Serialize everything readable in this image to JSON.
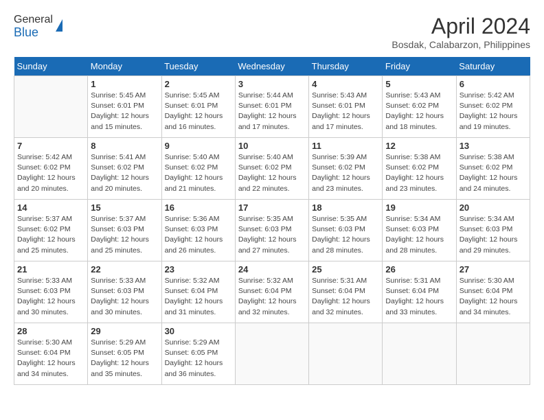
{
  "header": {
    "logo_general": "General",
    "logo_blue": "Blue",
    "month_title": "April 2024",
    "location": "Bosdak, Calabarzon, Philippines"
  },
  "columns": [
    "Sunday",
    "Monday",
    "Tuesday",
    "Wednesday",
    "Thursday",
    "Friday",
    "Saturday"
  ],
  "weeks": [
    [
      {
        "day": "",
        "info": ""
      },
      {
        "day": "1",
        "info": "Sunrise: 5:45 AM\nSunset: 6:01 PM\nDaylight: 12 hours\nand 15 minutes."
      },
      {
        "day": "2",
        "info": "Sunrise: 5:45 AM\nSunset: 6:01 PM\nDaylight: 12 hours\nand 16 minutes."
      },
      {
        "day": "3",
        "info": "Sunrise: 5:44 AM\nSunset: 6:01 PM\nDaylight: 12 hours\nand 17 minutes."
      },
      {
        "day": "4",
        "info": "Sunrise: 5:43 AM\nSunset: 6:01 PM\nDaylight: 12 hours\nand 17 minutes."
      },
      {
        "day": "5",
        "info": "Sunrise: 5:43 AM\nSunset: 6:02 PM\nDaylight: 12 hours\nand 18 minutes."
      },
      {
        "day": "6",
        "info": "Sunrise: 5:42 AM\nSunset: 6:02 PM\nDaylight: 12 hours\nand 19 minutes."
      }
    ],
    [
      {
        "day": "7",
        "info": "Sunrise: 5:42 AM\nSunset: 6:02 PM\nDaylight: 12 hours\nand 20 minutes."
      },
      {
        "day": "8",
        "info": "Sunrise: 5:41 AM\nSunset: 6:02 PM\nDaylight: 12 hours\nand 20 minutes."
      },
      {
        "day": "9",
        "info": "Sunrise: 5:40 AM\nSunset: 6:02 PM\nDaylight: 12 hours\nand 21 minutes."
      },
      {
        "day": "10",
        "info": "Sunrise: 5:40 AM\nSunset: 6:02 PM\nDaylight: 12 hours\nand 22 minutes."
      },
      {
        "day": "11",
        "info": "Sunrise: 5:39 AM\nSunset: 6:02 PM\nDaylight: 12 hours\nand 23 minutes."
      },
      {
        "day": "12",
        "info": "Sunrise: 5:38 AM\nSunset: 6:02 PM\nDaylight: 12 hours\nand 23 minutes."
      },
      {
        "day": "13",
        "info": "Sunrise: 5:38 AM\nSunset: 6:02 PM\nDaylight: 12 hours\nand 24 minutes."
      }
    ],
    [
      {
        "day": "14",
        "info": "Sunrise: 5:37 AM\nSunset: 6:02 PM\nDaylight: 12 hours\nand 25 minutes."
      },
      {
        "day": "15",
        "info": "Sunrise: 5:37 AM\nSunset: 6:03 PM\nDaylight: 12 hours\nand 25 minutes."
      },
      {
        "day": "16",
        "info": "Sunrise: 5:36 AM\nSunset: 6:03 PM\nDaylight: 12 hours\nand 26 minutes."
      },
      {
        "day": "17",
        "info": "Sunrise: 5:35 AM\nSunset: 6:03 PM\nDaylight: 12 hours\nand 27 minutes."
      },
      {
        "day": "18",
        "info": "Sunrise: 5:35 AM\nSunset: 6:03 PM\nDaylight: 12 hours\nand 28 minutes."
      },
      {
        "day": "19",
        "info": "Sunrise: 5:34 AM\nSunset: 6:03 PM\nDaylight: 12 hours\nand 28 minutes."
      },
      {
        "day": "20",
        "info": "Sunrise: 5:34 AM\nSunset: 6:03 PM\nDaylight: 12 hours\nand 29 minutes."
      }
    ],
    [
      {
        "day": "21",
        "info": "Sunrise: 5:33 AM\nSunset: 6:03 PM\nDaylight: 12 hours\nand 30 minutes."
      },
      {
        "day": "22",
        "info": "Sunrise: 5:33 AM\nSunset: 6:03 PM\nDaylight: 12 hours\nand 30 minutes."
      },
      {
        "day": "23",
        "info": "Sunrise: 5:32 AM\nSunset: 6:04 PM\nDaylight: 12 hours\nand 31 minutes."
      },
      {
        "day": "24",
        "info": "Sunrise: 5:32 AM\nSunset: 6:04 PM\nDaylight: 12 hours\nand 32 minutes."
      },
      {
        "day": "25",
        "info": "Sunrise: 5:31 AM\nSunset: 6:04 PM\nDaylight: 12 hours\nand 32 minutes."
      },
      {
        "day": "26",
        "info": "Sunrise: 5:31 AM\nSunset: 6:04 PM\nDaylight: 12 hours\nand 33 minutes."
      },
      {
        "day": "27",
        "info": "Sunrise: 5:30 AM\nSunset: 6:04 PM\nDaylight: 12 hours\nand 34 minutes."
      }
    ],
    [
      {
        "day": "28",
        "info": "Sunrise: 5:30 AM\nSunset: 6:04 PM\nDaylight: 12 hours\nand 34 minutes."
      },
      {
        "day": "29",
        "info": "Sunrise: 5:29 AM\nSunset: 6:05 PM\nDaylight: 12 hours\nand 35 minutes."
      },
      {
        "day": "30",
        "info": "Sunrise: 5:29 AM\nSunset: 6:05 PM\nDaylight: 12 hours\nand 36 minutes."
      },
      {
        "day": "",
        "info": ""
      },
      {
        "day": "",
        "info": ""
      },
      {
        "day": "",
        "info": ""
      },
      {
        "day": "",
        "info": ""
      }
    ]
  ]
}
